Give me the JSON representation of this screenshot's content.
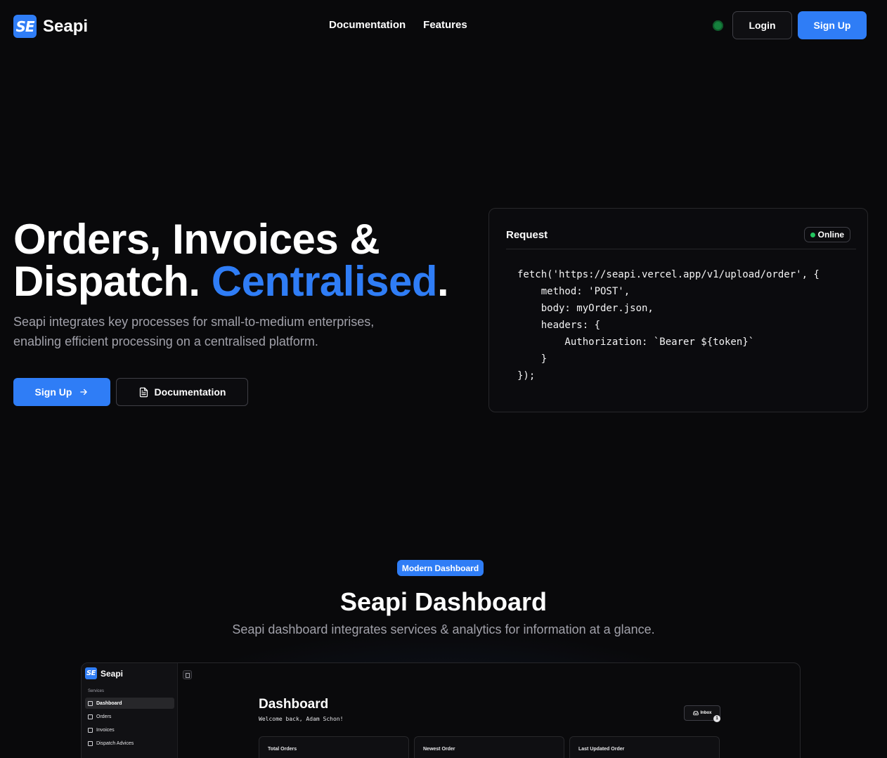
{
  "brand": {
    "logo_mark": "SE",
    "name": "Seapi"
  },
  "nav": {
    "links": [
      "Documentation",
      "Features"
    ],
    "status_color": "#15803d",
    "login_label": "Login",
    "signup_label": "Sign Up"
  },
  "hero": {
    "title_line1": "Orders, Invoices &",
    "title_line2_start": "Dispatch. ",
    "title_accent": "Centralised",
    "title_end": ".",
    "subtitle": "Seapi integrates key processes for small-to-medium enterprises, enabling efficient processing on a centralised platform.",
    "signup_label": "Sign Up",
    "signup_icon": "arrow-right-icon",
    "docs_label": "Documentation",
    "docs_icon": "document-icon"
  },
  "request_card": {
    "title": "Request",
    "status": "Online",
    "code": "fetch('https://seapi.vercel.app/v1/upload/order', {\n    method: 'POST',\n    body: myOrder.json,\n    headers: {\n        Authorization: `Bearer ${token}`\n    }\n});"
  },
  "dashboard_section": {
    "badge": "Modern Dashboard",
    "title": "Seapi Dashboard",
    "subtitle": "Seapi dashboard integrates services & analytics for information at a glance."
  },
  "preview": {
    "logo_mark": "SE",
    "brand": "Seapi",
    "section_label": "Services",
    "sidebar_items": [
      "Dashboard",
      "Orders",
      "Invoices",
      "Dispatch Advices"
    ],
    "title": "Dashboard",
    "welcome": "Welcome back, Adam Schon!",
    "inbox_label": "Inbox",
    "inbox_count": "1",
    "cards": [
      "Total Orders",
      "Newest Order",
      "Last Updated Order"
    ]
  },
  "colors": {
    "accent": "#2f7df6",
    "background": "#09090b",
    "online": "#22c55e"
  }
}
